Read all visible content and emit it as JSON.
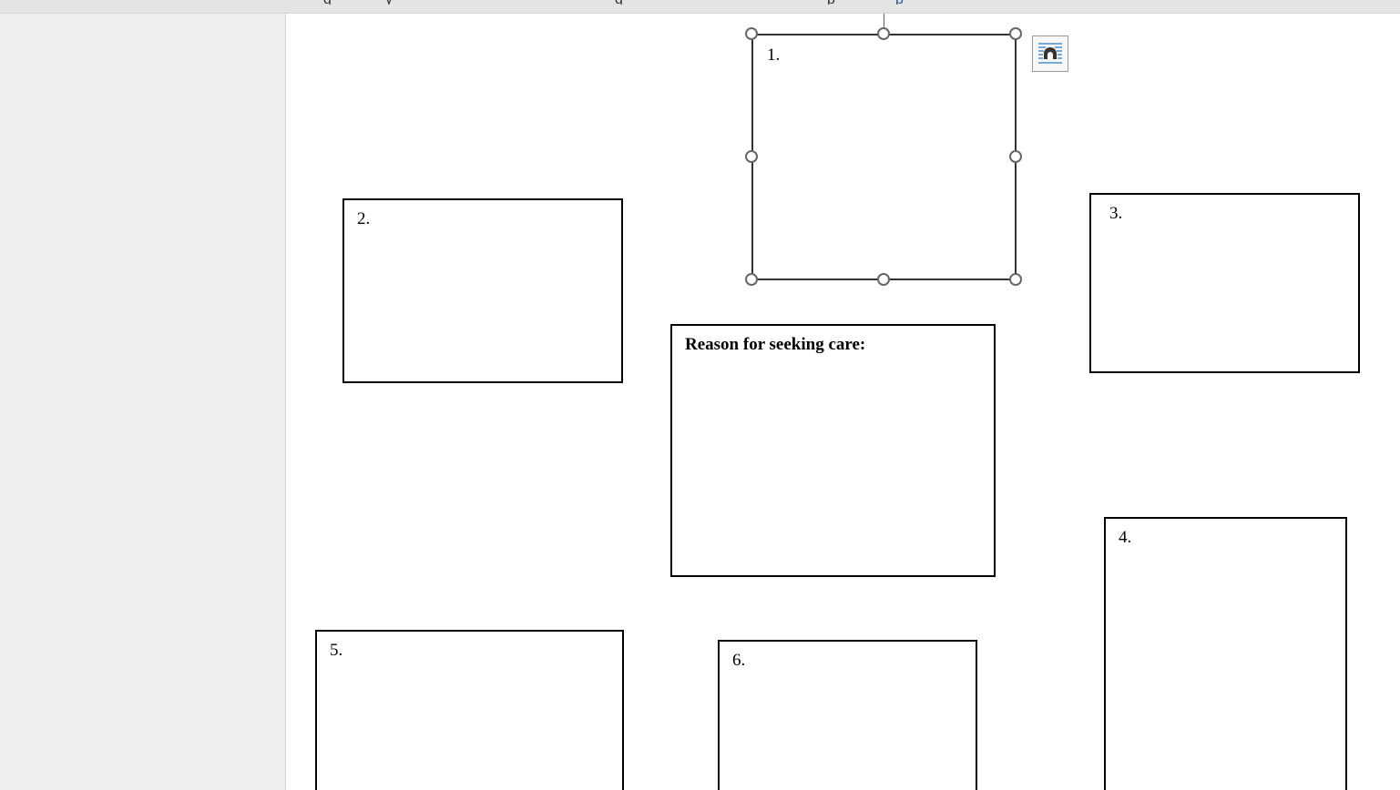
{
  "document": {
    "boxes": [
      {
        "label": "1."
      },
      {
        "label": "2."
      },
      {
        "label": "3."
      },
      {
        "label": "Reason for seeking care:"
      },
      {
        "label": "4."
      },
      {
        "label": "5."
      },
      {
        "label": "6."
      }
    ]
  },
  "icons": {
    "layout_options": "layout-options-icon"
  }
}
